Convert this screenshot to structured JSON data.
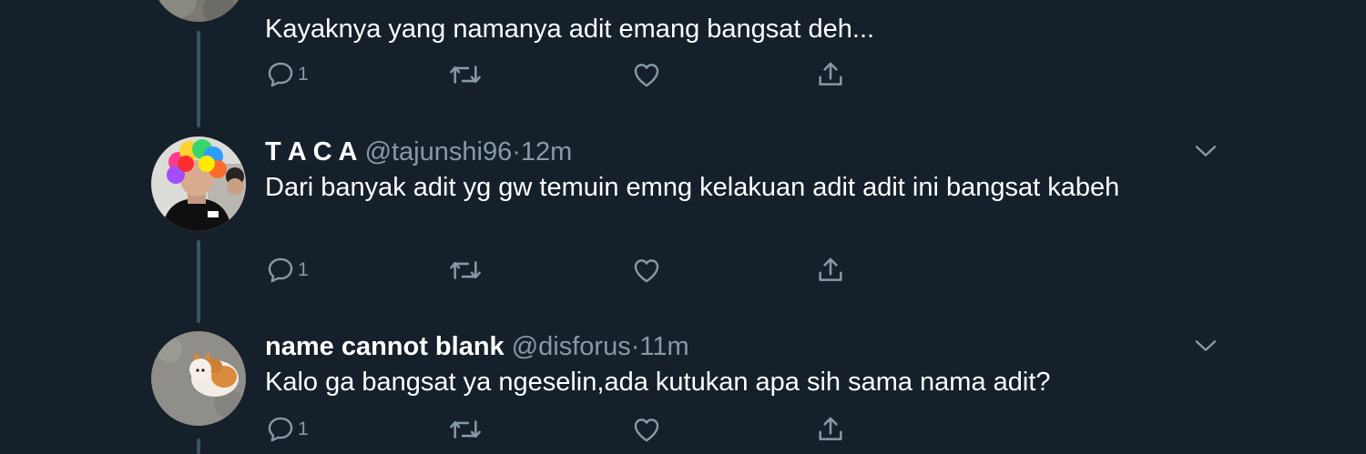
{
  "tweets": [
    {
      "name": "",
      "handle": "",
      "time": "",
      "text": "Kayaknya yang namanya adit emang bangsat deh...",
      "reply_count": "1",
      "avatar_icon": "avatar-gray-photo"
    },
    {
      "name": "T A C A",
      "handle": "@tajunshi96",
      "dot": "·",
      "time": "12m",
      "text": "Dari banyak adit yg gw temuin emng kelakuan adit adit ini bangsat kabeh",
      "reply_count": "1",
      "avatar_icon": "avatar-rainbow-wig"
    },
    {
      "name": "name cannot blank",
      "handle": "@disforus",
      "dot": "·",
      "time": "11m",
      "text": "Kalo ga bangsat ya ngeselin,ada kutukan apa sih sama nama adit?",
      "reply_count": "1",
      "avatar_icon": "avatar-kitten"
    }
  ],
  "colors": {
    "background": "#15202b",
    "text": "#ffffff",
    "secondary": "#8899a6",
    "thread_line": "#3d5466"
  },
  "icons": {
    "reply": "reply-icon",
    "retweet": "retweet-icon",
    "like": "heart-icon",
    "share": "share-icon",
    "more": "chevron-down-icon"
  }
}
